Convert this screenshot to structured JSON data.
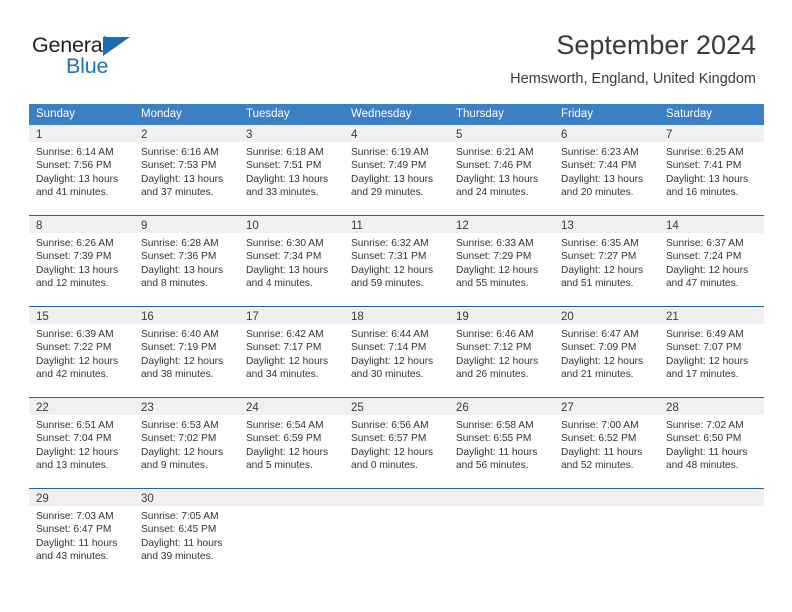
{
  "brand": {
    "name_part1": "General",
    "name_part2": "Blue",
    "colors": {
      "dark": "#231f20",
      "blue": "#1b75bb"
    }
  },
  "header": {
    "title": "September 2024",
    "subtitle": "Hemsworth, England, United Kingdom"
  },
  "theme": {
    "header_row_bg": "#3b7fc4",
    "week_divider": "#1f63a8",
    "day_band_bg": "#f0f0f0",
    "text": "#333333"
  },
  "calendar": {
    "day_headers": [
      "Sunday",
      "Monday",
      "Tuesday",
      "Wednesday",
      "Thursday",
      "Friday",
      "Saturday"
    ],
    "weeks": [
      [
        {
          "day": "1",
          "sunrise": "Sunrise: 6:14 AM",
          "sunset": "Sunset: 7:56 PM",
          "daylight1": "Daylight: 13 hours",
          "daylight2": "and 41 minutes."
        },
        {
          "day": "2",
          "sunrise": "Sunrise: 6:16 AM",
          "sunset": "Sunset: 7:53 PM",
          "daylight1": "Daylight: 13 hours",
          "daylight2": "and 37 minutes."
        },
        {
          "day": "3",
          "sunrise": "Sunrise: 6:18 AM",
          "sunset": "Sunset: 7:51 PM",
          "daylight1": "Daylight: 13 hours",
          "daylight2": "and 33 minutes."
        },
        {
          "day": "4",
          "sunrise": "Sunrise: 6:19 AM",
          "sunset": "Sunset: 7:49 PM",
          "daylight1": "Daylight: 13 hours",
          "daylight2": "and 29 minutes."
        },
        {
          "day": "5",
          "sunrise": "Sunrise: 6:21 AM",
          "sunset": "Sunset: 7:46 PM",
          "daylight1": "Daylight: 13 hours",
          "daylight2": "and 24 minutes."
        },
        {
          "day": "6",
          "sunrise": "Sunrise: 6:23 AM",
          "sunset": "Sunset: 7:44 PM",
          "daylight1": "Daylight: 13 hours",
          "daylight2": "and 20 minutes."
        },
        {
          "day": "7",
          "sunrise": "Sunrise: 6:25 AM",
          "sunset": "Sunset: 7:41 PM",
          "daylight1": "Daylight: 13 hours",
          "daylight2": "and 16 minutes."
        }
      ],
      [
        {
          "day": "8",
          "sunrise": "Sunrise: 6:26 AM",
          "sunset": "Sunset: 7:39 PM",
          "daylight1": "Daylight: 13 hours",
          "daylight2": "and 12 minutes."
        },
        {
          "day": "9",
          "sunrise": "Sunrise: 6:28 AM",
          "sunset": "Sunset: 7:36 PM",
          "daylight1": "Daylight: 13 hours",
          "daylight2": "and 8 minutes."
        },
        {
          "day": "10",
          "sunrise": "Sunrise: 6:30 AM",
          "sunset": "Sunset: 7:34 PM",
          "daylight1": "Daylight: 13 hours",
          "daylight2": "and 4 minutes."
        },
        {
          "day": "11",
          "sunrise": "Sunrise: 6:32 AM",
          "sunset": "Sunset: 7:31 PM",
          "daylight1": "Daylight: 12 hours",
          "daylight2": "and 59 minutes."
        },
        {
          "day": "12",
          "sunrise": "Sunrise: 6:33 AM",
          "sunset": "Sunset: 7:29 PM",
          "daylight1": "Daylight: 12 hours",
          "daylight2": "and 55 minutes."
        },
        {
          "day": "13",
          "sunrise": "Sunrise: 6:35 AM",
          "sunset": "Sunset: 7:27 PM",
          "daylight1": "Daylight: 12 hours",
          "daylight2": "and 51 minutes."
        },
        {
          "day": "14",
          "sunrise": "Sunrise: 6:37 AM",
          "sunset": "Sunset: 7:24 PM",
          "daylight1": "Daylight: 12 hours",
          "daylight2": "and 47 minutes."
        }
      ],
      [
        {
          "day": "15",
          "sunrise": "Sunrise: 6:39 AM",
          "sunset": "Sunset: 7:22 PM",
          "daylight1": "Daylight: 12 hours",
          "daylight2": "and 42 minutes."
        },
        {
          "day": "16",
          "sunrise": "Sunrise: 6:40 AM",
          "sunset": "Sunset: 7:19 PM",
          "daylight1": "Daylight: 12 hours",
          "daylight2": "and 38 minutes."
        },
        {
          "day": "17",
          "sunrise": "Sunrise: 6:42 AM",
          "sunset": "Sunset: 7:17 PM",
          "daylight1": "Daylight: 12 hours",
          "daylight2": "and 34 minutes."
        },
        {
          "day": "18",
          "sunrise": "Sunrise: 6:44 AM",
          "sunset": "Sunset: 7:14 PM",
          "daylight1": "Daylight: 12 hours",
          "daylight2": "and 30 minutes."
        },
        {
          "day": "19",
          "sunrise": "Sunrise: 6:46 AM",
          "sunset": "Sunset: 7:12 PM",
          "daylight1": "Daylight: 12 hours",
          "daylight2": "and 26 minutes."
        },
        {
          "day": "20",
          "sunrise": "Sunrise: 6:47 AM",
          "sunset": "Sunset: 7:09 PM",
          "daylight1": "Daylight: 12 hours",
          "daylight2": "and 21 minutes."
        },
        {
          "day": "21",
          "sunrise": "Sunrise: 6:49 AM",
          "sunset": "Sunset: 7:07 PM",
          "daylight1": "Daylight: 12 hours",
          "daylight2": "and 17 minutes."
        }
      ],
      [
        {
          "day": "22",
          "sunrise": "Sunrise: 6:51 AM",
          "sunset": "Sunset: 7:04 PM",
          "daylight1": "Daylight: 12 hours",
          "daylight2": "and 13 minutes."
        },
        {
          "day": "23",
          "sunrise": "Sunrise: 6:53 AM",
          "sunset": "Sunset: 7:02 PM",
          "daylight1": "Daylight: 12 hours",
          "daylight2": "and 9 minutes."
        },
        {
          "day": "24",
          "sunrise": "Sunrise: 6:54 AM",
          "sunset": "Sunset: 6:59 PM",
          "daylight1": "Daylight: 12 hours",
          "daylight2": "and 5 minutes."
        },
        {
          "day": "25",
          "sunrise": "Sunrise: 6:56 AM",
          "sunset": "Sunset: 6:57 PM",
          "daylight1": "Daylight: 12 hours",
          "daylight2": "and 0 minutes."
        },
        {
          "day": "26",
          "sunrise": "Sunrise: 6:58 AM",
          "sunset": "Sunset: 6:55 PM",
          "daylight1": "Daylight: 11 hours",
          "daylight2": "and 56 minutes."
        },
        {
          "day": "27",
          "sunrise": "Sunrise: 7:00 AM",
          "sunset": "Sunset: 6:52 PM",
          "daylight1": "Daylight: 11 hours",
          "daylight2": "and 52 minutes."
        },
        {
          "day": "28",
          "sunrise": "Sunrise: 7:02 AM",
          "sunset": "Sunset: 6:50 PM",
          "daylight1": "Daylight: 11 hours",
          "daylight2": "and 48 minutes."
        }
      ],
      [
        {
          "day": "29",
          "sunrise": "Sunrise: 7:03 AM",
          "sunset": "Sunset: 6:47 PM",
          "daylight1": "Daylight: 11 hours",
          "daylight2": "and 43 minutes."
        },
        {
          "day": "30",
          "sunrise": "Sunrise: 7:05 AM",
          "sunset": "Sunset: 6:45 PM",
          "daylight1": "Daylight: 11 hours",
          "daylight2": "and 39 minutes."
        },
        {
          "day": "",
          "sunrise": "",
          "sunset": "",
          "daylight1": "",
          "daylight2": ""
        },
        {
          "day": "",
          "sunrise": "",
          "sunset": "",
          "daylight1": "",
          "daylight2": ""
        },
        {
          "day": "",
          "sunrise": "",
          "sunset": "",
          "daylight1": "",
          "daylight2": ""
        },
        {
          "day": "",
          "sunrise": "",
          "sunset": "",
          "daylight1": "",
          "daylight2": ""
        },
        {
          "day": "",
          "sunrise": "",
          "sunset": "",
          "daylight1": "",
          "daylight2": ""
        }
      ]
    ]
  }
}
